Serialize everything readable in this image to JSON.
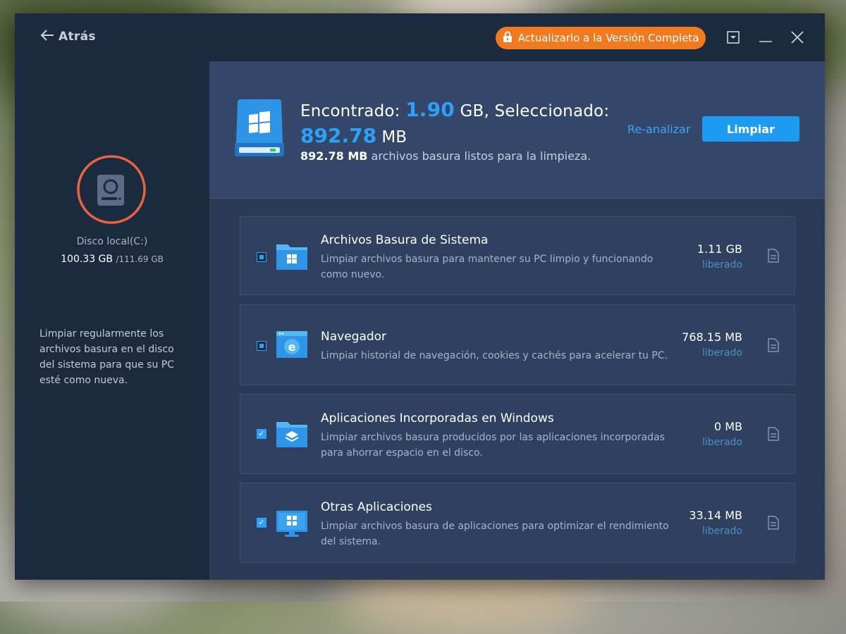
{
  "header": {
    "back_label": "Atrás",
    "upgrade_label": "Actualizarlo a la Versión Completa"
  },
  "colors": {
    "window_bg": "#1c2a40",
    "panel_bg": "#2b3b56",
    "accent": "#2da0f7",
    "upgrade": "#f07a1d",
    "disk_ring": "#e8643c"
  },
  "sidebar": {
    "disk_name": "Disco local(C:)",
    "disk_used": "100.33 GB",
    "disk_total": "/111.69 GB",
    "tip": "Limpiar regularmente los archivos basura en el disco del sistema para que su PC esté como nueva."
  },
  "summary": {
    "found_label": "Encontrado:",
    "found_value": "1.90",
    "found_unit": "GB, Seleccionado:",
    "selected_value": "892.78",
    "selected_unit": "MB",
    "detail_value": "892.78 MB",
    "detail_text": "archivos basura listos para la limpieza.",
    "rescan_label": "Re-analizar",
    "clean_label": "Limpiar"
  },
  "items": [
    {
      "title": "Archivos Basura de Sistema",
      "desc": "Limpiar archivos basura para mantener su PC limpio y funcionando como nuevo.",
      "size": "1.11 GB",
      "freed": "liberado",
      "check": "partial",
      "icon": "windows-folder-icon"
    },
    {
      "title": "Navegador",
      "desc": "Limpiar historial de navegación, cookies y cachés para acelerar tu PC.",
      "size": "768.15 MB",
      "freed": "liberado",
      "check": "partial",
      "icon": "browser-icon"
    },
    {
      "title": "Aplicaciones Incorporadas en Windows",
      "desc": "Limpiar archivos basura producidos por las aplicaciones incorporadas para ahorrar espacio en el disco.",
      "size": "0 MB",
      "freed": "liberado",
      "check": "checked",
      "icon": "layers-folder-icon"
    },
    {
      "title": "Otras Aplicaciones",
      "desc": "Limpiar archivos basura de aplicaciones para optimizar el rendimiento del sistema.",
      "size": "33.14 MB",
      "freed": "liberado",
      "check": "checked",
      "icon": "apps-monitor-icon"
    }
  ]
}
